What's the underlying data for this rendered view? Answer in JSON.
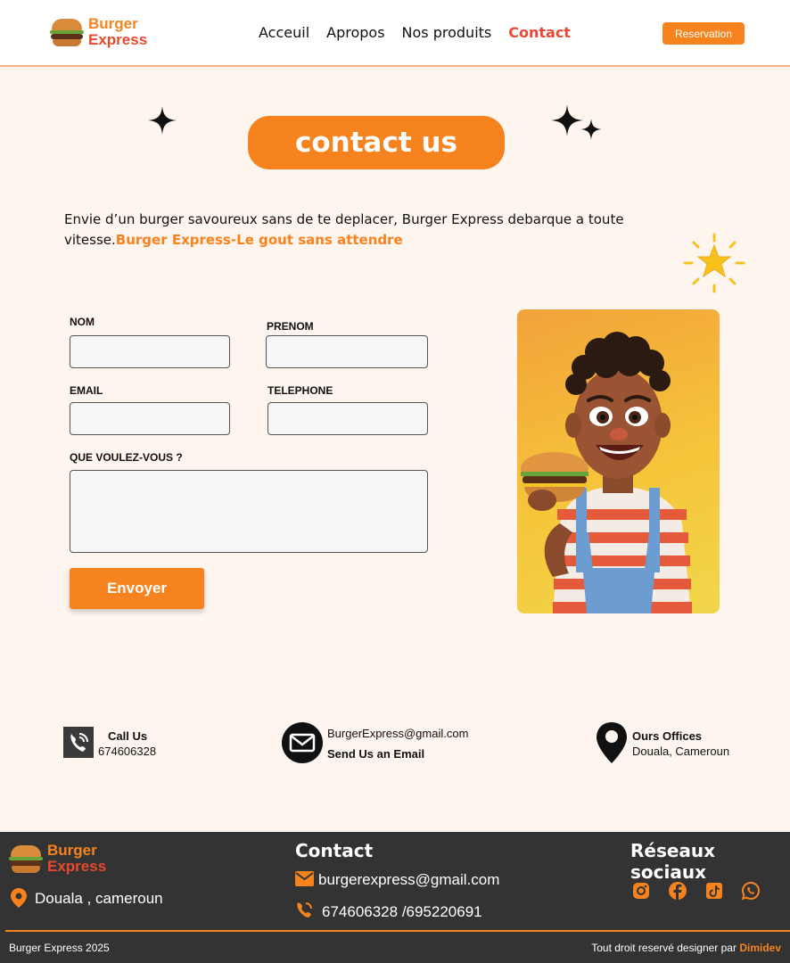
{
  "header": {
    "logo_line1": "Burger",
    "logo_line2": "Express",
    "nav": [
      "Acceuil",
      "Apropos",
      "Nos produits",
      "Contact"
    ],
    "active_nav": "Contact",
    "reservation_label": "Reservation"
  },
  "hero": {
    "title": "contact us",
    "intro_text": "Envie d’un burger savoureux sans de te deplacer, Burger Express debarque a toute vitesse.",
    "intro_tagline": "Burger Express-Le gout sans attendre"
  },
  "form": {
    "nom_label": "NOM",
    "prenom_label": "PRENOM",
    "email_label": "EMAIL",
    "telephone_label": "TELEPHONE",
    "message_label": "QUE VOULEZ-VOUS ?",
    "nom_value": "",
    "prenom_value": "",
    "email_value": "",
    "telephone_value": "",
    "message_value": "",
    "submit_label": "Envoyer"
  },
  "contact_info": {
    "call_title": "Call Us",
    "call_number": "674606328",
    "email_address": "BurgerExpress@gmail.com",
    "email_title": "Send Us an Email",
    "office_title": "Ours Offices",
    "office_location": "Douala, Cameroun"
  },
  "footer": {
    "logo_line1": "Burger",
    "logo_line2": "Express",
    "location": "Douala , cameroun",
    "contact_heading": "Contact",
    "email": "burgerexpress@gmail.com",
    "phone": "674606328 /695220691",
    "social_heading": "Réseaux sociaux",
    "social_icons": [
      "instagram-icon",
      "facebook-icon",
      "tiktok-icon",
      "whatsapp-icon"
    ],
    "copyright": "Burger Express 2025",
    "rights_text": "Tout droit reservé designer par ",
    "designer": "Dimidev"
  },
  "colors": {
    "accent": "#f7831e",
    "active_nav": "#e84a35",
    "background": "#fdf5ee",
    "footer_bg": "#333333"
  }
}
